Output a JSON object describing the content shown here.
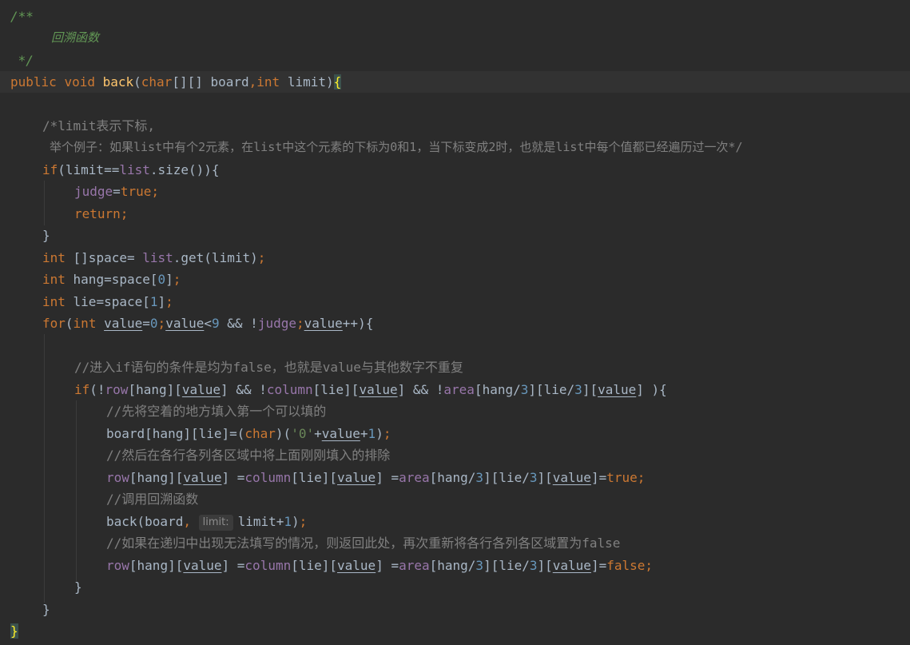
{
  "code": {
    "doc_open": "/**",
    "doc_text": "回溯函数",
    "doc_close": " */",
    "sig_public": "public",
    "sig_void": "void",
    "sig_name": "back",
    "sig_char": "char",
    "sig_board": "[][] board",
    "sig_int": "int",
    "sig_limit": " limit)",
    "comment1": "/*limit表示下标,",
    "comment2": "举个例子：如果list中有个2元素，在list中这个元素的下标为0和1，当下标变成2时，也就是list中每个值都已经遍历过一次*/",
    "cm_if_cond": "//进入if语句的条件是均为false，也就是value与其他数字不重复",
    "cm_fill": "//先将空着的地方填入第一个可以填的",
    "cm_exclude": "//然后在各行各列各区域中将上面刚刚填入的排除",
    "cm_recurse": "//调用回溯函数",
    "hint_limit": "limit:",
    "cm_reset": "//如果在递归中出现无法填写的情况，则返回此处，再次重新将各行各列各区域置为false"
  }
}
